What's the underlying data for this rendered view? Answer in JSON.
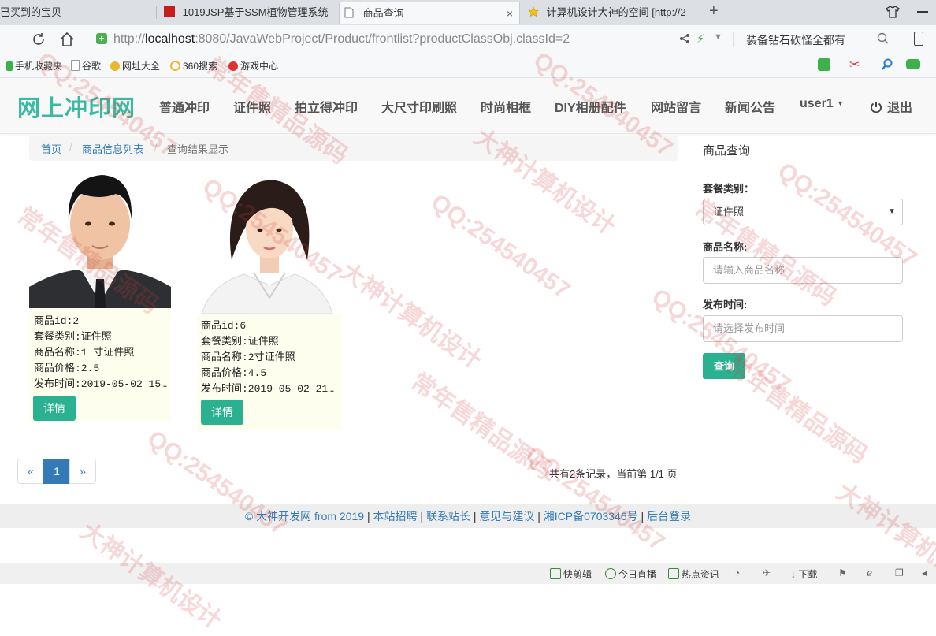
{
  "browser": {
    "tabs": [
      {
        "label": "已买到的宝贝"
      },
      {
        "label": "1019JSP基于SSM植物管理系统"
      },
      {
        "label": "商品查询",
        "close": "×"
      },
      {
        "label": "计算机设计大神的空间 [http://2"
      }
    ],
    "new_tab": "+",
    "url_prefix": "http://",
    "url_host": "localhost",
    "url_rest": ":8080/JavaWebProject/Product/frontlist?productClassObj.classId=2",
    "search_text": "装备钻石砍怪全都有",
    "bookmarks": [
      "手机收藏夹",
      "谷歌",
      "网址大全",
      "360搜索",
      "游戏中心"
    ]
  },
  "site": {
    "brand": "网上冲印网",
    "menu": [
      "普通冲印",
      "证件照",
      "拍立得冲印",
      "大尺寸印刷照",
      "时尚相框",
      "DIY相册配件",
      "网站留言",
      "新闻公告"
    ],
    "user": "user1",
    "logout": "退出"
  },
  "breadcrumb": {
    "home": "首页",
    "list": "商品信息列表",
    "current": "查询结果显示",
    "separator": "/"
  },
  "products": [
    {
      "id_line": "商品id:2",
      "class_line": "套餐类别:证件照",
      "name_line": "商品名称:1 寸证件照",
      "price_line": "商品价格:2.5",
      "time_line": "发布时间:2019-05-02 15…",
      "detail": "详情"
    },
    {
      "id_line": "商品id:6",
      "class_line": "套餐类别:证件照",
      "name_line": "商品名称:2寸证件照",
      "price_line": "商品价格:4.5",
      "time_line": "发布时间:2019-05-02 21…",
      "detail": "详情"
    }
  ],
  "pager": {
    "prev": "«",
    "page": "1",
    "next": "»",
    "summary": "共有2条记录，当前第 1/1 页"
  },
  "query": {
    "title": "商品查询",
    "class_label": "套餐类别：",
    "class_value": "证件照",
    "name_label": "商品名称:",
    "name_placeholder": "请输入商品名称",
    "time_label": "发布时间:",
    "time_placeholder": "请选择发布时间",
    "submit": "查询"
  },
  "footer": {
    "copyright": "© 大神开发网 from 2019",
    "links": [
      "本站招聘",
      "联系站长",
      "意见与建议",
      "湘ICP备0703346号",
      "后台登录"
    ],
    "sep": "|"
  },
  "statusbar": [
    "快剪辑",
    "今日直播",
    "热点资讯",
    "下载"
  ],
  "watermark": [
    "QQ:254540457",
    "大神计算机设计",
    "常年售精品源码"
  ],
  "colors": {
    "brand": "#3cb9a1",
    "button": "#2ab190",
    "link": "#337ab7",
    "watermark": "#d73c3c"
  }
}
